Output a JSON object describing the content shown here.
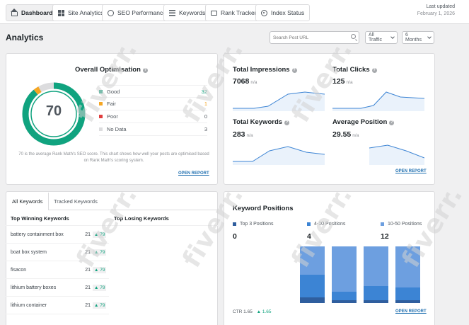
{
  "tabs": [
    {
      "label": "Dashboard",
      "icon": "home-icon",
      "active": true
    },
    {
      "label": "Site Analytics",
      "icon": "grid-icon"
    },
    {
      "label": "SEO Performance",
      "icon": "seo-icon"
    },
    {
      "label": "Keywords",
      "icon": "list-icon"
    },
    {
      "label": "Rank Tracker",
      "icon": "monitor-icon"
    },
    {
      "label": "Index Status",
      "icon": "index-icon"
    }
  ],
  "updated": {
    "label": "Last updated",
    "date": "February 1, 2026"
  },
  "page_title": "Analytics",
  "search": {
    "placeholder": "Search Post URL"
  },
  "filters": {
    "traffic": "All Traffic",
    "range": "6 Months"
  },
  "optimisation": {
    "title": "Overall Optimisation",
    "score": "70",
    "score_value": 70,
    "legend": [
      {
        "label": "Good",
        "count": "32",
        "color": "#10a37f",
        "count_color": "#10a37f"
      },
      {
        "label": "Fair",
        "count": "1",
        "color": "#f5a623",
        "count_color": "#f5a623"
      },
      {
        "label": "Poor",
        "count": "0",
        "color": "#e03e3e",
        "count_color": "#50575e"
      },
      {
        "label": "No Data",
        "count": "3",
        "color": "#dcdcde",
        "count_color": "#50575e"
      }
    ],
    "note": "70 is the average Rank Math's SEO score. This chart shows how well your posts are optimised based on Rank Math's scoring system.",
    "link": "OPEN REPORT"
  },
  "stats": {
    "impressions": {
      "title": "Total Impressions",
      "value": "7068",
      "na": "n/a"
    },
    "clicks": {
      "title": "Total Clicks",
      "value": "125",
      "na": "n/a"
    },
    "keywords": {
      "title": "Total Keywords",
      "value": "283",
      "na": "n/a"
    },
    "position": {
      "title": "Average Position",
      "value": "29.55",
      "na": "n/a"
    },
    "link": "OPEN REPORT"
  },
  "keywords_card": {
    "tab_all": "All Keywords",
    "tab_tracked": "Tracked Keywords",
    "col_winning": "Top Winning Keywords",
    "col_losing": "Top Losing Keywords",
    "rows": [
      {
        "name": "battery containment box",
        "pos": "21",
        "diff": "▲ 79"
      },
      {
        "name": "boat box system",
        "pos": "21",
        "diff": "▲ 79"
      },
      {
        "name": "fisacon",
        "pos": "21",
        "diff": "▲ 79"
      },
      {
        "name": "lithium battery boxes",
        "pos": "21",
        "diff": "▲ 79"
      },
      {
        "name": "lithium container",
        "pos": "21",
        "diff": "▲ 79"
      }
    ]
  },
  "keyword_positions": {
    "title": "Keyword Positions",
    "legend": [
      {
        "label": "Top 3 Positions",
        "value": "0",
        "color": "#2f5e9e"
      },
      {
        "label": "4-10 Positions",
        "value": "4",
        "color": "#3c84d4"
      },
      {
        "label": "10-50 Positions",
        "value": "12",
        "color": "#6d9fe0"
      }
    ],
    "ctr_label": "CTR",
    "ctr_value": "1.65",
    "ctr_change": "▲ 1.65",
    "link": "OPEN REPORT"
  },
  "watermark": "fiverr."
}
